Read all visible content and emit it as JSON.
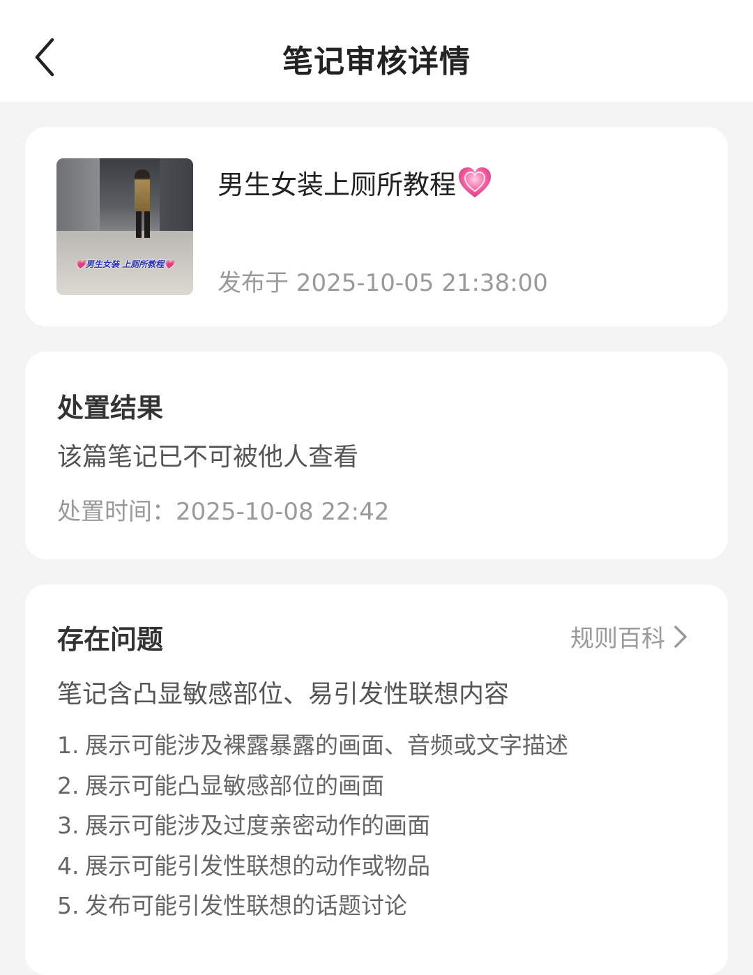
{
  "header": {
    "title": "笔记审核详情",
    "back_icon": "chevron-left-icon"
  },
  "note": {
    "title": "男生女装上厕所教程",
    "title_emoji": "growing-heart-icon",
    "thumbnail_caption": "💗男生女装 上厕所教程💗",
    "publish_time": "发布于 2025-10-05 21:38:00"
  },
  "result": {
    "title": "处置结果",
    "subtitle": "该篇笔记已不可被他人查看",
    "time": "处置时间：2025-10-08 22:42"
  },
  "issue": {
    "title": "存在问题",
    "rules_link": "规则百科",
    "summary": "笔记含凸显敏感部位、易引发性联想内容",
    "items": [
      {
        "num": "1.",
        "text": "展示可能涉及裸露暴露的画面、音频或文字描述"
      },
      {
        "num": "2.",
        "text": "展示可能凸显敏感部位的画面"
      },
      {
        "num": "3.",
        "text": "展示可能涉及过度亲密动作的画面"
      },
      {
        "num": "4.",
        "text": "展示可能引发性联想的动作或物品"
      },
      {
        "num": "5.",
        "text": "发布可能引发性联想的话题讨论"
      }
    ]
  },
  "colors": {
    "background": "#f4f4f4",
    "card": "#ffffff",
    "muted_text": "#9a9a9a",
    "heart": "#f0609e"
  }
}
